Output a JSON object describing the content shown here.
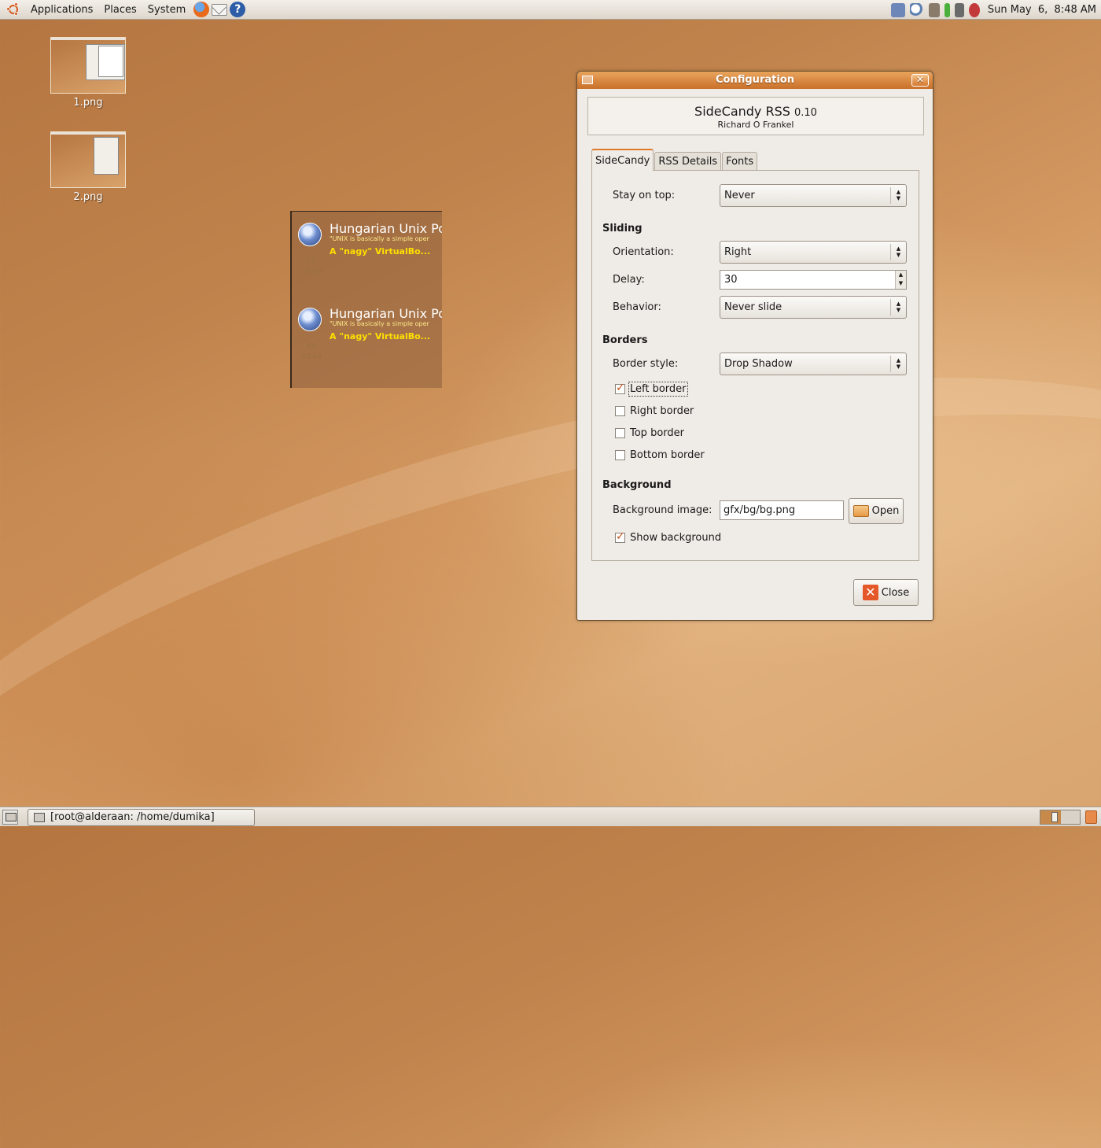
{
  "top_panel": {
    "menus": [
      "Applications",
      "Places",
      "System"
    ],
    "clock": "Sun May  6,  8:48 AM"
  },
  "desktop_icons": [
    {
      "label": "1.png"
    },
    {
      "label": "2.png"
    }
  ],
  "sidecandy_widget": {
    "feeds": [
      {
        "title": "Hungarian Unix Po",
        "subtitle": "\"UNIX is basically a simple oper",
        "item": "A \"nagy\" VirtualBo...",
        "meta_1": "Ell",
        "meta_2": "08:42"
      },
      {
        "title": "Hungarian Unix Po",
        "subtitle": "\"UNIX is basically a simple oper",
        "item": "A \"nagy\" VirtualBo...",
        "meta_1": "Ell",
        "meta_2": "08:44"
      }
    ]
  },
  "dialog": {
    "title": "Configuration",
    "close_glyph": "✕",
    "about": {
      "name": "SideCandy RSS",
      "version": "0.10",
      "author": "Richard O Frankel"
    },
    "tabs": [
      {
        "label": "SideCandy",
        "active": true
      },
      {
        "label": "RSS Details",
        "active": false
      },
      {
        "label": "Fonts",
        "active": false
      }
    ],
    "stay_on_top": {
      "label": "Stay on top:",
      "value": "Never"
    },
    "sliding": {
      "heading": "Sliding",
      "orientation": {
        "label": "Orientation:",
        "value": "Right"
      },
      "delay": {
        "label": "Delay:",
        "value": "30"
      },
      "behavior": {
        "label": "Behavior:",
        "value": "Never slide"
      }
    },
    "borders": {
      "heading": "Borders",
      "style": {
        "label": "Border style:",
        "value": "Drop Shadow"
      },
      "left": {
        "label": "Left border",
        "checked": true
      },
      "right": {
        "label": "Right border",
        "checked": false
      },
      "top": {
        "label": "Top border",
        "checked": false
      },
      "bottom": {
        "label": "Bottom border",
        "checked": false
      }
    },
    "background": {
      "heading": "Background",
      "image_label": "Background image:",
      "image_value": "gfx/bg/bg.png",
      "open_label": "Open",
      "show_label": "Show background",
      "show_checked": true
    },
    "close_button": "Close"
  },
  "bottom_panel": {
    "task": "[root@alderaan: /home/dumika]"
  },
  "colors": {
    "accent": "#e07a2a",
    "titlebar": "#d98b43",
    "desktop": "#c0834c"
  }
}
